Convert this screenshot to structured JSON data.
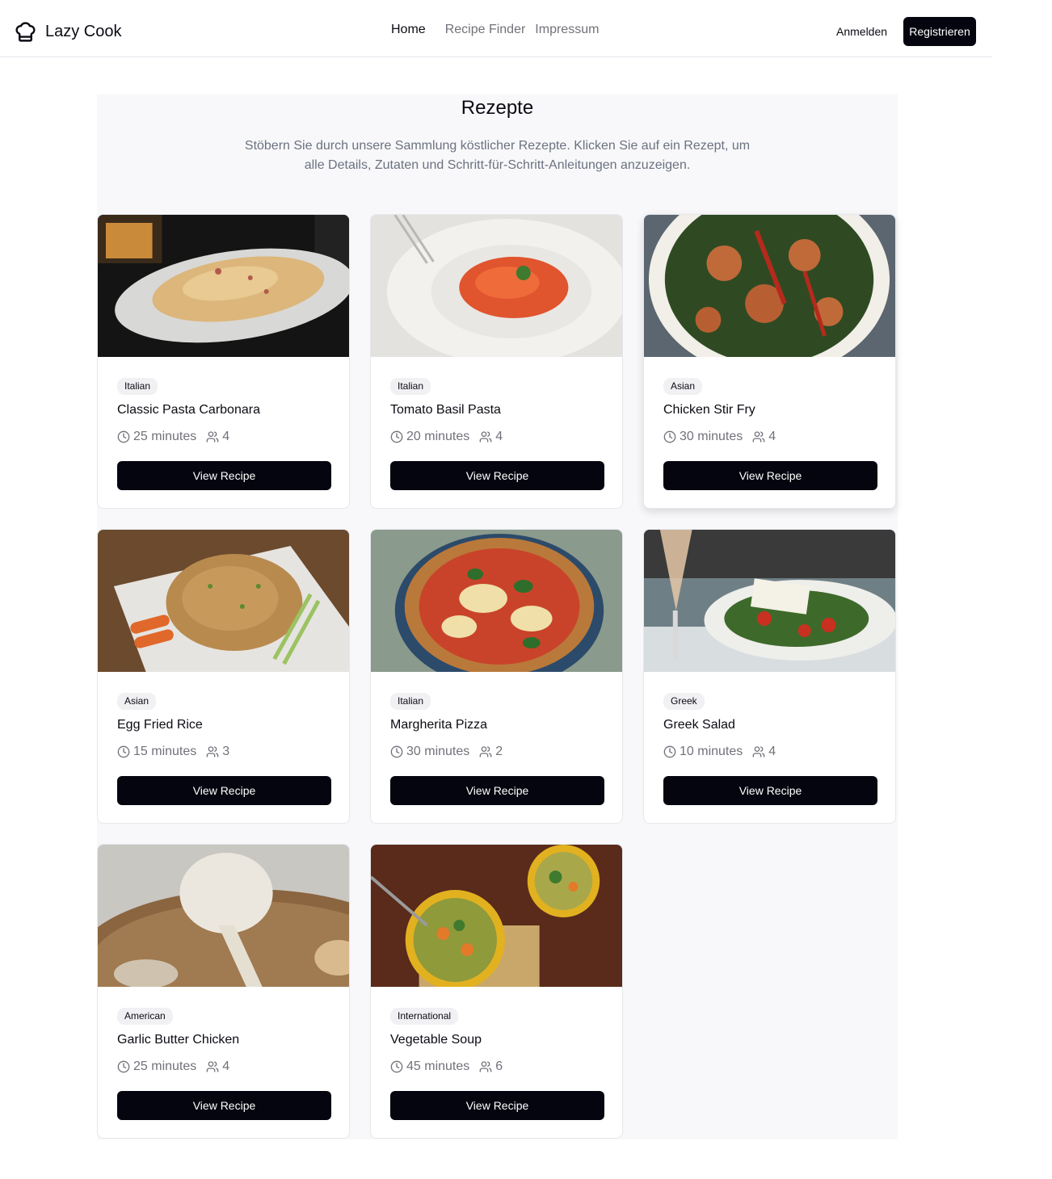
{
  "header": {
    "brand": "Lazy Cook",
    "nav": [
      "Home",
      "Recipe Finder",
      "Impressum"
    ],
    "login": "Anmelden",
    "register": "Registrieren"
  },
  "main": {
    "title": "Rezepte",
    "subtitle": "Stöbern Sie durch unsere Sammlung köstlicher Rezepte. Klicken Sie auf ein Rezept, um alle Details, Zutaten und Schritt-für-Schritt-Anleitungen anzuzeigen."
  },
  "recipes": [
    {
      "cuisine": "Italian",
      "title": "Classic Pasta Carbonara",
      "time": "25 minutes",
      "servings": "4",
      "button": "View Recipe"
    },
    {
      "cuisine": "Italian",
      "title": "Tomato Basil Pasta",
      "time": "20 minutes",
      "servings": "4",
      "button": "View Recipe"
    },
    {
      "cuisine": "Asian",
      "title": "Chicken Stir Fry",
      "time": "30 minutes",
      "servings": "4",
      "button": "View Recipe"
    },
    {
      "cuisine": "Asian",
      "title": "Egg Fried Rice",
      "time": "15 minutes",
      "servings": "3",
      "button": "View Recipe"
    },
    {
      "cuisine": "Italian",
      "title": "Margherita Pizza",
      "time": "30 minutes",
      "servings": "2",
      "button": "View Recipe"
    },
    {
      "cuisine": "Greek",
      "title": "Greek Salad",
      "time": "10 minutes",
      "servings": "4",
      "button": "View Recipe"
    },
    {
      "cuisine": "American",
      "title": "Garlic Butter Chicken",
      "time": "25 minutes",
      "servings": "4",
      "button": "View Recipe"
    },
    {
      "cuisine": "International",
      "title": "Vegetable Soup",
      "time": "45 minutes",
      "servings": "6",
      "button": "View Recipe"
    }
  ],
  "icons": {
    "brand": "chef-hat-icon",
    "time": "clock-icon",
    "servings": "users-icon"
  },
  "colors": {
    "primary": "#05050f",
    "muted_text": "#71717a",
    "section_bg": "#f8f8fa",
    "badge_bg": "#f1f1f4",
    "border": "#e5e7eb"
  }
}
